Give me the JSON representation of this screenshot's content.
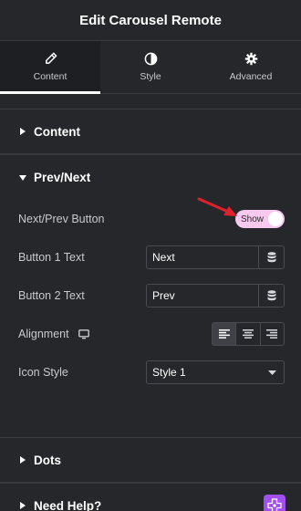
{
  "header": {
    "title": "Edit Carousel Remote"
  },
  "tabs": [
    {
      "label": "Content",
      "icon": "pencil-icon",
      "active": true
    },
    {
      "label": "Style",
      "icon": "half-circle-icon",
      "active": false
    },
    {
      "label": "Advanced",
      "icon": "gear-icon",
      "active": false
    }
  ],
  "sections": {
    "content": {
      "label": "Content",
      "open": false
    },
    "prevnext": {
      "label": "Prev/Next",
      "open": true,
      "controls": {
        "nextprev_button": {
          "label": "Next/Prev Button",
          "toggle_text": "Show",
          "value": true
        },
        "button1": {
          "label": "Button 1 Text",
          "value": "Next"
        },
        "button2": {
          "label": "Button 2 Text",
          "value": "Prev"
        },
        "alignment": {
          "label": "Alignment",
          "selected": "left",
          "options": [
            "left",
            "center",
            "right"
          ]
        },
        "icon_style": {
          "label": "Icon Style",
          "value": "Style 1"
        }
      }
    },
    "dots": {
      "label": "Dots",
      "open": false
    },
    "help": {
      "label": "Need Help?",
      "open": false
    }
  },
  "colors": {
    "background": "#26272b",
    "toggle_on": "#f7c9ee",
    "help_accent": "#a34ff0",
    "annotation_arrow": "#e0202a"
  }
}
